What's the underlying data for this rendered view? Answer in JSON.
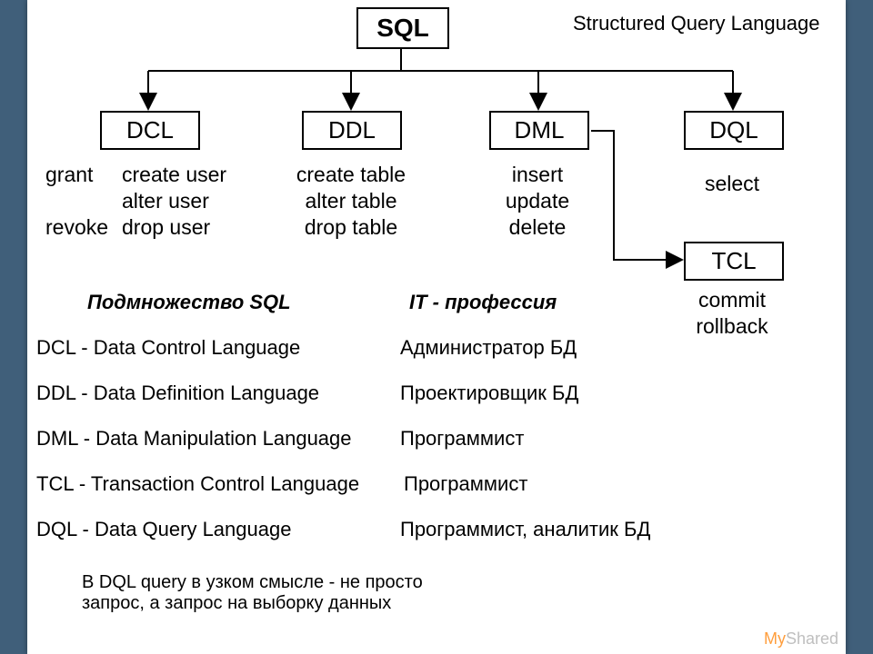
{
  "root": "SQL",
  "root_full": "Structured Query Language",
  "branches": {
    "dcl": {
      "title": "DCL",
      "cmds_col1": "grant\n\nrevoke",
      "cmds_col2": "create user\nalter user\ndrop user"
    },
    "ddl": {
      "title": "DDL",
      "cmds": "create table\nalter table\ndrop table"
    },
    "dml": {
      "title": "DML",
      "cmds": "insert\nupdate\ndelete"
    },
    "dql": {
      "title": "DQL",
      "cmds": "select"
    },
    "tcl": {
      "title": "TCL",
      "cmds": "commit\nrollback"
    }
  },
  "headings": {
    "subset": "Подмножество SQL",
    "profession": "IT - профессия"
  },
  "defs": {
    "dcl": "DCL - Data Control Language",
    "ddl": "DDL - Data Definition Language",
    "dml": "DML - Data Manipulation Language",
    "tcl": "TCL - Transaction Control Language",
    "dql": "DQL - Data Query Language"
  },
  "professions": {
    "p1": "Администратор БД",
    "p2": "Проектировщик БД",
    "p3": "Программист",
    "p4": "Программист",
    "p5": "Программист, аналитик БД"
  },
  "footnote": "В DQL query в узком смысле - не просто\nзапрос, а запрос на выборку данных",
  "watermark": {
    "a": "My",
    "b": "Shared"
  }
}
